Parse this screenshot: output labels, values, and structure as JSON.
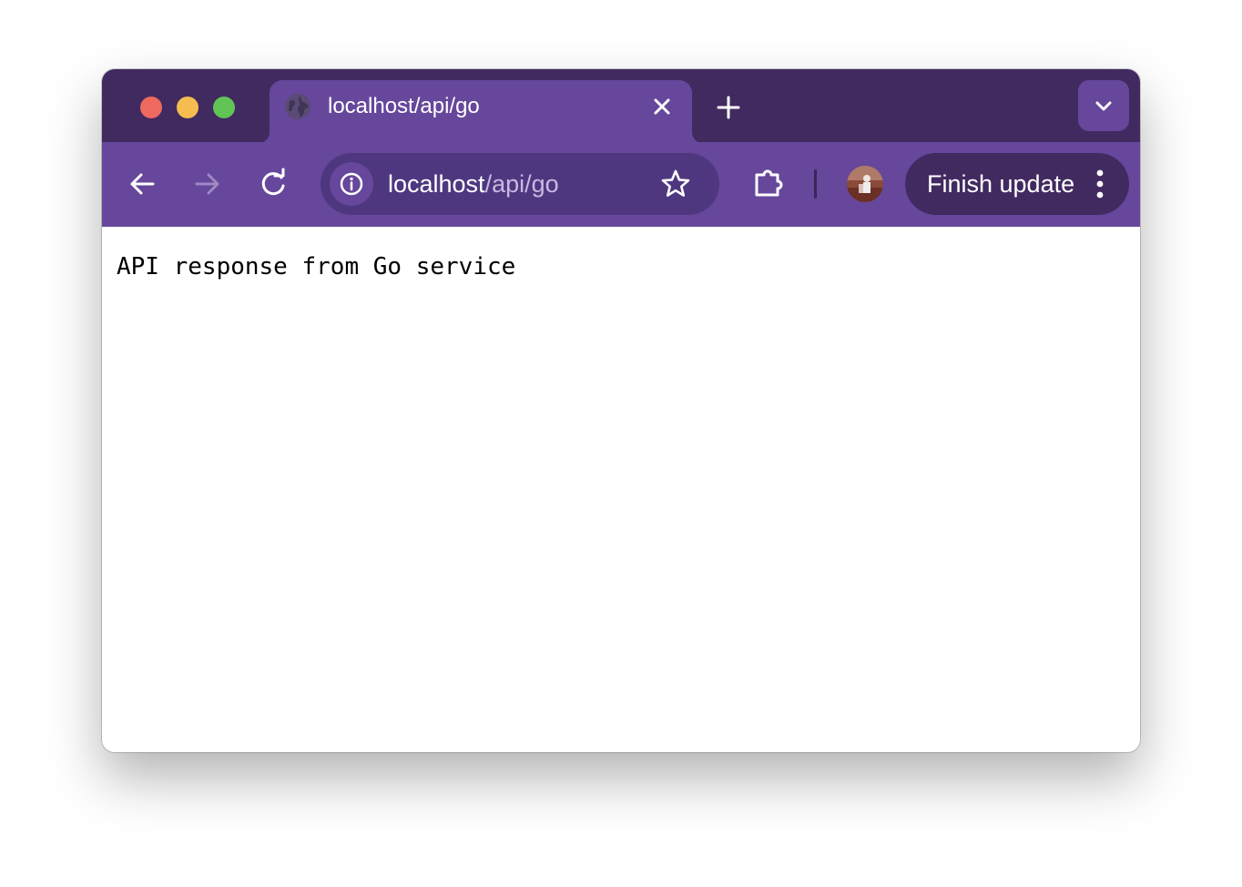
{
  "tab": {
    "title": "localhost/api/go",
    "favicon": "globe-icon"
  },
  "address_bar": {
    "host": "localhost",
    "path": "/api/go"
  },
  "toolbar": {
    "update_label": "Finish update"
  },
  "page": {
    "body_text": "API response from Go service"
  },
  "colors": {
    "titlebar": "#412a60",
    "toolbar": "#66479b",
    "omnibox": "#4f3780",
    "close_dot": "#ee6a5f",
    "minimize_dot": "#f5bd4f",
    "zoom_dot": "#61c455"
  }
}
